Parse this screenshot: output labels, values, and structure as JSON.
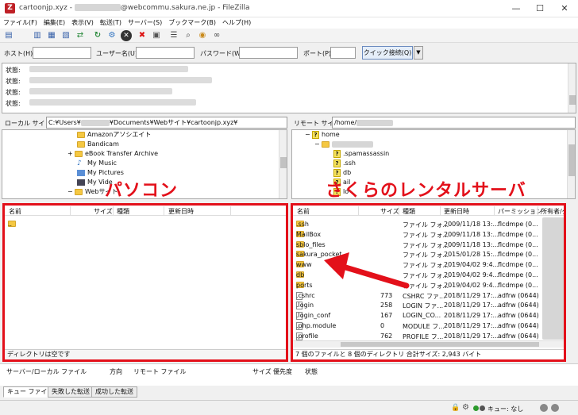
{
  "window": {
    "title_prefix": "cartoonjp.xyz - ",
    "title_suffix": "@webcommu.sakura.ne.jp - FileZilla",
    "app_icon": "Z",
    "minimize": "—",
    "maximize": "☐",
    "close": "✕"
  },
  "menu": [
    "ファイル(F)",
    "編集(E)",
    "表示(V)",
    "転送(T)",
    "サーバー(S)",
    "ブックマーク(B)",
    "ヘルプ(H)"
  ],
  "toolbar_icons": [
    "site-manager-icon",
    "toggle-log-icon",
    "toggle-local-tree-icon",
    "toggle-remote-tree-icon",
    "transfer-queue-icon",
    "refresh-icon",
    "process-queue-icon",
    "cancel-icon",
    "disconnect-icon",
    "reconnect-icon",
    "filter-icon",
    "compare-icon",
    "sync-browse-icon",
    "search-icon"
  ],
  "quickconnect": {
    "host_label": "ホスト(H):",
    "user_label": "ユーザー名(U):",
    "pass_label": "パスワード(W):",
    "port_label": "ポート(P):",
    "button": "クイック接続(Q)",
    "dropdown": "▼"
  },
  "log": {
    "lines": [
      "状態:",
      "状態:",
      "状態:",
      "状態:"
    ]
  },
  "local_site": {
    "label": "ローカル サイト:",
    "path_prefix": "C:¥Users¥",
    "path_suffix": "¥Documents¥Webサイト¥cartoonjp.xyz¥"
  },
  "remote_site": {
    "label": "リモート サイト:",
    "path": "/home/"
  },
  "local_tree": [
    {
      "label": "Amazonアソシエイト",
      "icon": "folder"
    },
    {
      "label": "Bandicam",
      "icon": "folder"
    },
    {
      "label": "eBook Transfer Archive",
      "icon": "folder",
      "expand": "+"
    },
    {
      "label": "My Music",
      "icon": "music"
    },
    {
      "label": "My Pictures",
      "icon": "pictures"
    },
    {
      "label": "My Vide",
      "icon": "video"
    },
    {
      "label": "Webサイト",
      "icon": "folder",
      "expand": "−"
    }
  ],
  "remote_tree": [
    {
      "label": "home",
      "icon": "unknown",
      "expand": "−"
    },
    {
      "label": "",
      "icon": "folder",
      "expand": "−"
    },
    {
      "label": ".spamassassin",
      "icon": "unknown"
    },
    {
      "label": ".ssh",
      "icon": "unknown"
    },
    {
      "label": "db",
      "icon": "unknown"
    },
    {
      "label": "ail",
      "icon": "unknown"
    },
    {
      "label": "lo",
      "icon": "unknown"
    }
  ],
  "annotations": {
    "local": "パソコン",
    "remote": "さくらのレンタルサーバ"
  },
  "local_list": {
    "headers": [
      "名前",
      "サイズ",
      "種類",
      "更新日時"
    ],
    "rows": [
      ".."
    ],
    "status": "ディレクトリは空です"
  },
  "remote_list": {
    "headers": [
      "名前",
      "サイズ",
      "種類",
      "更新日時",
      "パーミッション",
      "所有者/グ"
    ],
    "rows": [
      {
        "name": ".ssh",
        "size": "",
        "type": "ファイル フォ...",
        "date": "2009/11/18 13:...",
        "perm": "flcdmpe (0...",
        "icon": "folder"
      },
      {
        "name": "MailBox",
        "size": "",
        "type": "ファイル フォ...",
        "date": "2009/11/18 13:...",
        "perm": "flcdmpe (0...",
        "icon": "folder"
      },
      {
        "name": "sblo_files",
        "size": "",
        "type": "ファイル フォ...",
        "date": "2009/11/18 13:...",
        "perm": "flcdmpe (0...",
        "icon": "folder"
      },
      {
        "name": "sakura_pocket",
        "size": "",
        "type": "ファイル フォ...",
        "date": "2015/01/28 15:...",
        "perm": "flcdmpe (0...",
        "icon": "folder"
      },
      {
        "name": "www",
        "size": "",
        "type": "ファイル フォ...",
        "date": "2019/04/02 9:4...",
        "perm": "flcdmpe (0...",
        "icon": "folder"
      },
      {
        "name": "db",
        "size": "",
        "type": "ファイル フォ...",
        "date": "2019/04/02 9:4...",
        "perm": "flcdmpe (0...",
        "icon": "folder"
      },
      {
        "name": "ports",
        "size": "",
        "type": "ファイル フォ...",
        "date": "2019/04/02 9:4...",
        "perm": "flcdmpe (0...",
        "icon": "folder"
      },
      {
        "name": ".cshrc",
        "size": "773",
        "type": "CSHRC ファ...",
        "date": "2018/11/29 17:...",
        "perm": "adfrw (0644)",
        "icon": "file"
      },
      {
        "name": ".login",
        "size": "258",
        "type": "LOGIN ファ...",
        "date": "2018/11/29 17:...",
        "perm": "adfrw (0644)",
        "icon": "file"
      },
      {
        "name": ".login_conf",
        "size": "167",
        "type": "LOGIN_CO...",
        "date": "2018/11/29 17:...",
        "perm": "adfrw (0644)",
        "icon": "file"
      },
      {
        "name": ".php.module",
        "size": "0",
        "type": "MODULE フ...",
        "date": "2018/11/29 17:...",
        "perm": "adfrw (0644)",
        "icon": "file"
      },
      {
        "name": ".profile",
        "size": "762",
        "type": "PROFILE フ...",
        "date": "2018/11/29 17:...",
        "perm": "adfrw (0644)",
        "icon": "file"
      }
    ],
    "status": "7 個のファイルと 8 個のディレクトリ 合計サイズ: 2,943 バイト"
  },
  "queue": {
    "headers": [
      "サーバー/ローカル ファイル",
      "方向",
      "リモート ファイル",
      "サイズ",
      "優先度",
      "状態"
    ]
  },
  "tabs": [
    "キュー ファイル",
    "失敗した転送",
    "成功した転送"
  ],
  "statusbar": {
    "queue": "キュー: なし"
  },
  "colors": {
    "highlight": "#e3101a",
    "folder": "#f5c842"
  }
}
